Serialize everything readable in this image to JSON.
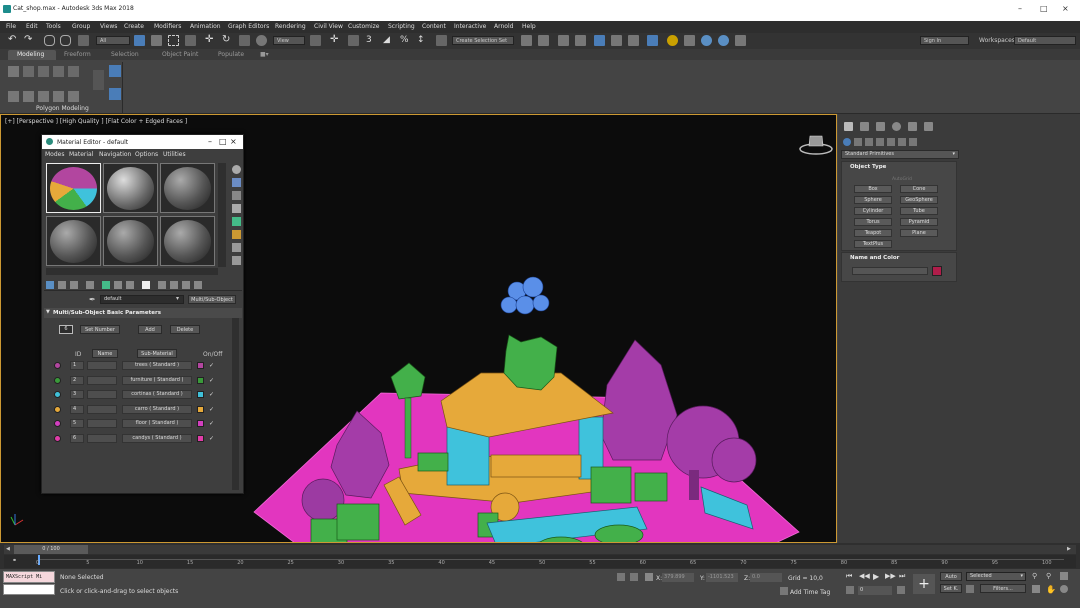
{
  "window": {
    "title": "Cat_shop.max - Autodesk 3ds Max 2018"
  },
  "menu": [
    "File",
    "Edit",
    "Tools",
    "Group",
    "Views",
    "Create",
    "Modifiers",
    "Animation",
    "Graph Editors",
    "Rendering",
    "Civil View",
    "Customize",
    "Scripting",
    "Content",
    "Interactive",
    "Arnold",
    "Help"
  ],
  "account": {
    "sign_in": "Sign In",
    "workspaces_label": "Workspaces:",
    "workspace": "Default"
  },
  "toolbar": {
    "filter": "All",
    "ref_coord": "View",
    "selection_set": "Create Selection Set"
  },
  "ribbon": {
    "tabs": [
      "Modeling",
      "Freeform",
      "Selection",
      "Object Paint",
      "Populate"
    ],
    "panel_label": "Polygon Modeling"
  },
  "viewport": {
    "label": "[+] [Perspective ] [High Quality ] [Flat Color + Edged Faces ]"
  },
  "material_editor": {
    "title": "Material Editor - default",
    "menus": [
      "Modes",
      "Material",
      "Navigation",
      "Options",
      "Utilities"
    ],
    "material_name": "default",
    "material_type": "Multi/Sub-Object",
    "rollout": "Multi/Sub-Object Basic Parameters",
    "count": "6",
    "set_number": "Set Number",
    "add": "Add",
    "delete": "Delete",
    "headers": {
      "id": "ID",
      "name": "Name",
      "sub": "Sub-Material",
      "onoff": "On/Off"
    },
    "rows": [
      {
        "id": "1",
        "sub": "trees  ( Standard )",
        "color": "#b2469f"
      },
      {
        "id": "2",
        "sub": "furniture  ( Standard )",
        "color": "#3a9a3a"
      },
      {
        "id": "3",
        "sub": "cortinas  ( Standard )",
        "color": "#40c0d8"
      },
      {
        "id": "4",
        "sub": "carro  ( Standard )",
        "color": "#e6a93a"
      },
      {
        "id": "5",
        "sub": "floor  ( Standard )",
        "color": "#d23fbf"
      },
      {
        "id": "6",
        "sub": "candys  ( Standard )",
        "color": "#e03ca8"
      }
    ]
  },
  "command_panel": {
    "category": "Standard Primitives",
    "object_type": "Object Type",
    "autogrid": "AutoGrid",
    "buttons": [
      "Box",
      "Cone",
      "Sphere",
      "GeoSphere",
      "Cylinder",
      "Tube",
      "Torus",
      "Pyramid",
      "Teapot",
      "Plane",
      "TextPlus"
    ],
    "name_color": "Name and Color",
    "name_color_swatch": "#b01d4a"
  },
  "timeline": {
    "frame": "0 / 100",
    "ticks": [
      "0",
      "5",
      "10",
      "15",
      "20",
      "25",
      "30",
      "35",
      "40",
      "45",
      "50",
      "55",
      "60",
      "65",
      "70",
      "75",
      "80",
      "85",
      "90",
      "95",
      "100"
    ]
  },
  "status": {
    "selection": "None Selected",
    "prompt": "Click or click-and-drag to select objects",
    "maxscript": "MAXScript Mi",
    "x_label": "X:",
    "x": "379.899",
    "y_label": "Y:",
    "y": "-1101.523",
    "z_label": "Z:",
    "z": "0.0",
    "grid": "Grid = 10,0",
    "add_time_tag": "Add Time Tag",
    "auto": "Auto",
    "set_key": "Set K.",
    "key_mode": "Selected",
    "filters": "Filters...",
    "frame_field": "0"
  }
}
